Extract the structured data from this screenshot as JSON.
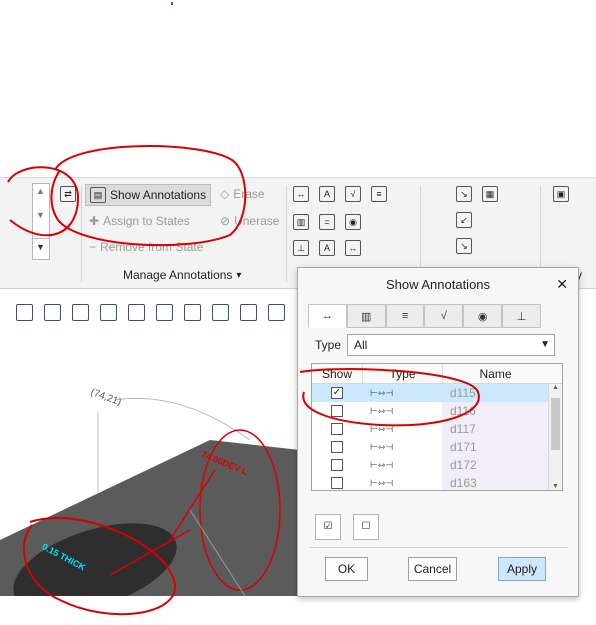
{
  "ribbon": {
    "show_annotations": "Show Annotations",
    "erase": "Erase",
    "assign_to_states": "Assign to States",
    "unerase": "Unerase",
    "remove_from_state": "Remove from State",
    "group_label": "Manage Annotations",
    "group_arrow": "▾",
    "right_label_fragment": "y"
  },
  "dialog": {
    "title": "Show Annotations",
    "close": "✕",
    "type_label": "Type",
    "type_value": "All",
    "columns": {
      "show": "Show",
      "type": "Type",
      "name": "Name"
    },
    "rows": [
      {
        "checked": true,
        "name": "d115"
      },
      {
        "checked": false,
        "name": "d116"
      },
      {
        "checked": false,
        "name": "d117"
      },
      {
        "checked": false,
        "name": "d171"
      },
      {
        "checked": false,
        "name": "d172"
      },
      {
        "checked": false,
        "name": "d163"
      }
    ],
    "ok": "OK",
    "cancel": "Cancel",
    "apply": "Apply"
  },
  "model": {
    "coord_label": "(74,21)",
    "thick_label": "0.15 THICK",
    "dim_label": "74.00DEV L"
  },
  "colors": {
    "accent_red": "#d90000",
    "model_gray": "#5b5b5b",
    "cyan_label": "#00e5ff",
    "row_selected": "#cce8ff"
  }
}
